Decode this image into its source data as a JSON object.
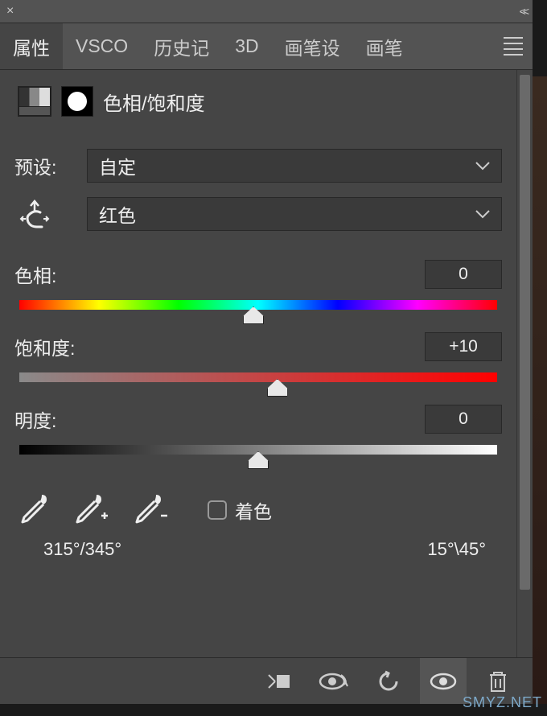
{
  "topbar": {
    "close": "×",
    "collapse": "<<"
  },
  "tabs": {
    "items": [
      "属性",
      "VSCO",
      "历史记",
      "3D",
      "画笔设",
      "画笔"
    ],
    "active_index": 0
  },
  "adjustment": {
    "title": "色相/饱和度"
  },
  "preset": {
    "label": "预设:",
    "value": "自定"
  },
  "channel": {
    "value": "红色"
  },
  "sliders": {
    "hue": {
      "label": "色相:",
      "value": "0",
      "position_pct": 49
    },
    "saturation": {
      "label": "饱和度:",
      "value": "+10",
      "position_pct": 54
    },
    "lightness": {
      "label": "明度:",
      "value": "0",
      "position_pct": 50
    }
  },
  "colorize": {
    "label": "着色",
    "checked": false
  },
  "range": {
    "left": "315°/345°",
    "right": "15°\\45°"
  },
  "watermark": "SMYZ.NET"
}
